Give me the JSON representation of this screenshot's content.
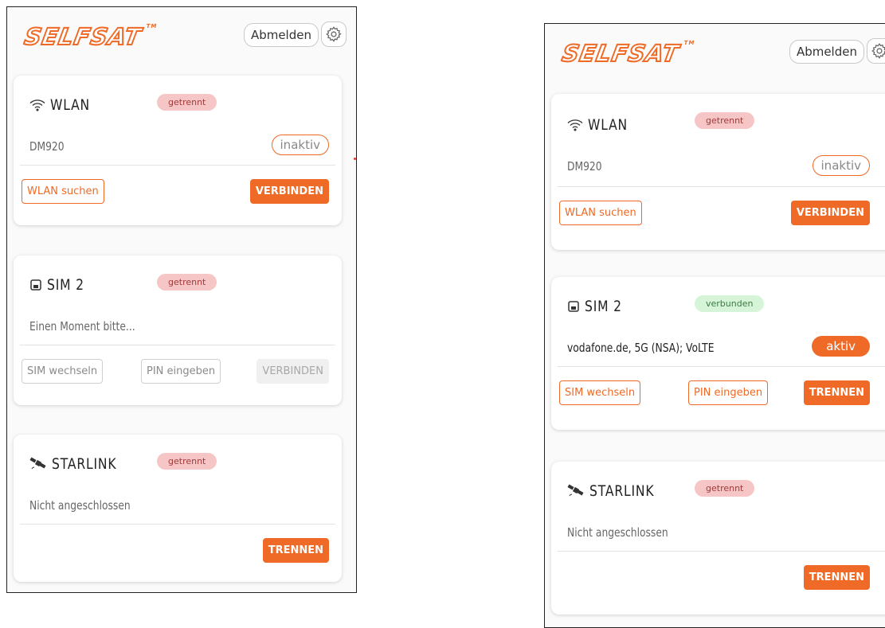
{
  "brand": {
    "logo": "SELFSAT",
    "tm": "TM"
  },
  "header": {
    "logout_label": "Abmelden",
    "settings_icon": "gear-icon"
  },
  "colors": {
    "accent": "#ee6a26",
    "badge_disconnected": "#f6c6c6",
    "badge_connected": "#d6f5d8"
  },
  "left": {
    "wlan": {
      "title": "WLAN",
      "status": "getrennt",
      "info": "DM920",
      "state": "inaktiv",
      "btn_search": "WLAN suchen",
      "btn_connect": "VERBINDEN"
    },
    "sim": {
      "title": "SIM 2",
      "status": "getrennt",
      "info": "Einen Moment bitte...",
      "btn_switch": "SIM wechseln",
      "btn_pin": "PIN eingeben",
      "btn_connect": "VERBINDEN"
    },
    "starlink": {
      "title": "STARLINK",
      "status": "getrennt",
      "info": "Nicht angeschlossen",
      "btn_disconnect": "TRENNEN"
    }
  },
  "right": {
    "wlan": {
      "title": "WLAN",
      "status": "getrennt",
      "info": "DM920",
      "state": "inaktiv",
      "btn_search": "WLAN suchen",
      "btn_connect": "VERBINDEN"
    },
    "sim": {
      "title": "SIM 2",
      "status": "verbunden",
      "info": "vodafone.de, 5G (NSA); VoLTE",
      "state": "aktiv",
      "btn_switch": "SIM wechseln",
      "btn_pin": "PIN eingeben",
      "btn_disconnect": "TRENNEN"
    },
    "starlink": {
      "title": "STARLINK",
      "status": "getrennt",
      "info": "Nicht angeschlossen",
      "btn_disconnect": "TRENNEN"
    }
  }
}
